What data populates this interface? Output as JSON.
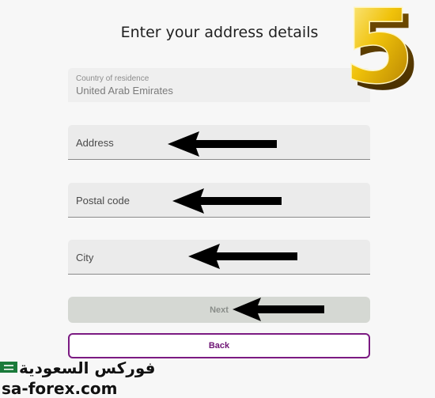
{
  "form": {
    "title": "Enter your address details",
    "country": {
      "label": "Country of residence",
      "value": "United Arab Emirates"
    },
    "address": {
      "placeholder": "Address"
    },
    "postal": {
      "placeholder": "Postal code"
    },
    "city": {
      "placeholder": "City"
    },
    "next_label": "Next",
    "back_label": "Back"
  },
  "overlay": {
    "step_number": "5",
    "watermark_ar": "فوركس السعودية",
    "watermark_url": "sa-forex.com"
  },
  "colors": {
    "back_border": "#7b1a82",
    "next_bg": "#d5d8d3",
    "field_bg": "#ebebeb",
    "step_gold": "#e8b400"
  },
  "icons": [
    "arrow-left-icon",
    "step-five-badge",
    "saudi-flag-icon"
  ]
}
